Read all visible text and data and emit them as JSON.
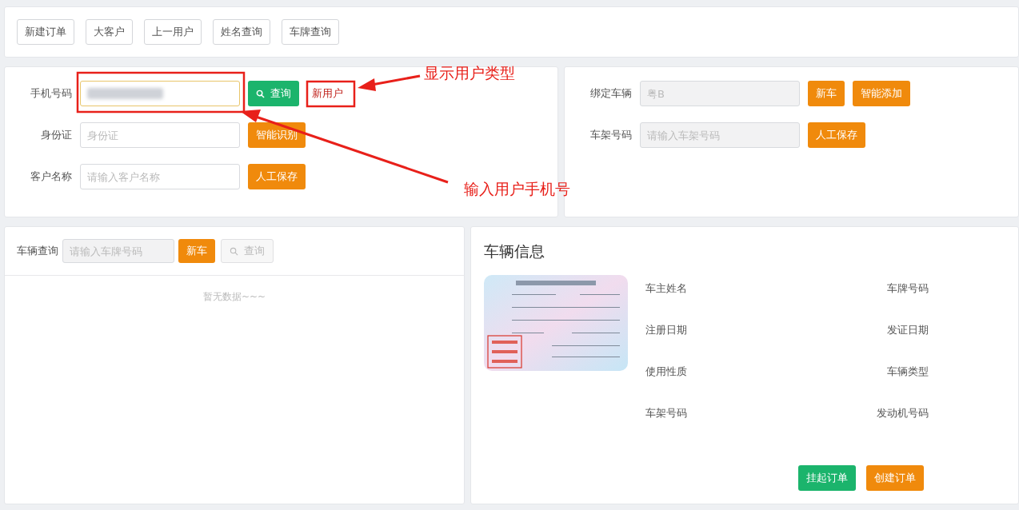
{
  "toolbar": {
    "buttons": [
      "新建订单",
      "大客户",
      "上一用户",
      "姓名查询",
      "车牌查询"
    ]
  },
  "customer_form": {
    "rows": [
      {
        "label": "手机号码",
        "kind": "phone",
        "button": {
          "label": "查询",
          "kind": "search"
        },
        "user_type": "新用户"
      },
      {
        "label": "身份证",
        "kind": "text",
        "placeholder": "身份证",
        "button": {
          "label": "智能识别",
          "kind": "action"
        }
      },
      {
        "label": "客户名称",
        "kind": "text",
        "placeholder": "请输入客户名称",
        "button": {
          "label": "人工保存",
          "kind": "action"
        }
      }
    ]
  },
  "vehicle_binding": {
    "rows": [
      {
        "label": "绑定车辆",
        "placeholder": "粤B",
        "disabled": true,
        "buttons": [
          "新车",
          "智能添加"
        ]
      },
      {
        "label": "车架号码",
        "placeholder": "请输入车架号码",
        "disabled": true,
        "buttons": [
          "人工保存"
        ]
      }
    ]
  },
  "vehicle_search": {
    "label": "车辆查询",
    "placeholder": "请输入车牌号码",
    "new_button": "新车",
    "search_button": "查询",
    "search_disabled": true,
    "empty_text": "暂无数据~~~"
  },
  "vehicle_info": {
    "title": "车辆信息",
    "fields": [
      "车主姓名",
      "车牌号码",
      "注册日期",
      "发证日期",
      "使用性质",
      "车辆类型",
      "车架号码",
      "发动机号码"
    ],
    "buttons": [
      {
        "label": "挂起订单",
        "kind": "green"
      },
      {
        "label": "创建订单",
        "kind": "orange"
      }
    ]
  },
  "annotations": [
    {
      "text": "显示用户类型"
    },
    {
      "text": "输入用户手机号"
    }
  ]
}
